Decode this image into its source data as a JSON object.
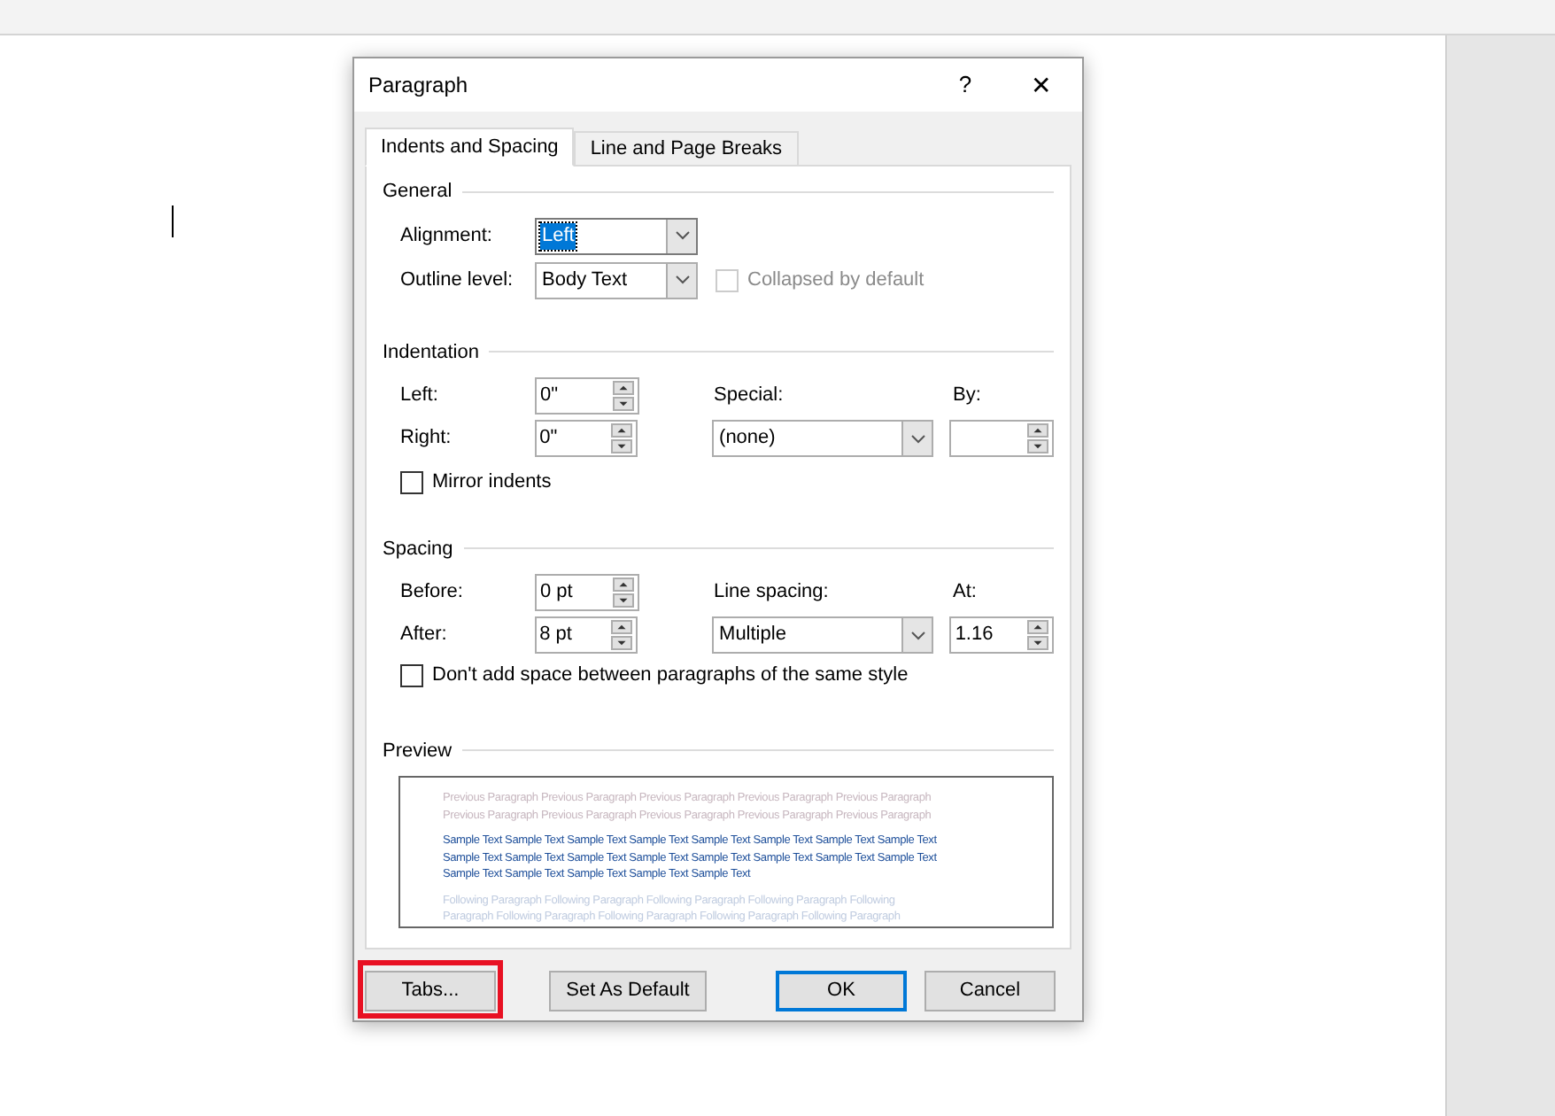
{
  "dialog": {
    "title": "Paragraph",
    "help": "?",
    "close": "✕"
  },
  "tabs": [
    {
      "label": "Indents and Spacing",
      "selected": true
    },
    {
      "label": "Line and Page Breaks",
      "selected": false
    }
  ],
  "general": {
    "heading": "General",
    "alignment": {
      "label": "Alignment:",
      "value": "Left",
      "focused": true
    },
    "outline": {
      "label": "Outline level:",
      "value": "Body Text",
      "focused": false
    },
    "collapsed": {
      "label": "Collapsed by default",
      "checked": false,
      "disabled": true
    }
  },
  "indentation": {
    "heading": "Indentation",
    "left": {
      "label": "Left:",
      "value": "0\""
    },
    "right": {
      "label": "Right:",
      "value": "0\""
    },
    "special": {
      "label": "Special:",
      "value": "(none)"
    },
    "by": {
      "label": "By:"
    },
    "mirror": {
      "label": "Mirror indents",
      "checked": false,
      "disabled": false
    }
  },
  "spacing": {
    "heading": "Spacing",
    "before": {
      "label": "Before:",
      "value": "0 pt"
    },
    "after": {
      "label": "After:",
      "value": "8 pt"
    },
    "line_spacing": {
      "label": "Line spacing:",
      "value": "Multiple"
    },
    "at": {
      "label": "At:",
      "value": "1.16"
    },
    "no_space": {
      "label": "Don't add space between paragraphs of the same style",
      "checked": false,
      "disabled": false
    }
  },
  "preview": {
    "heading": "Preview",
    "previous": [
      "Previous Paragraph Previous Paragraph Previous Paragraph Previous Paragraph Previous Paragraph",
      "Previous Paragraph Previous Paragraph Previous Paragraph Previous Paragraph Previous Paragraph"
    ],
    "sample": [
      "Sample Text Sample Text Sample Text Sample Text Sample Text Sample Text Sample Text Sample Text",
      "Sample Text Sample Text Sample Text Sample Text Sample Text Sample Text Sample Text Sample Text",
      "Sample Text Sample Text Sample Text Sample Text Sample Text"
    ],
    "following": [
      "Following Paragraph Following Paragraph Following Paragraph Following Paragraph Following",
      "Paragraph Following Paragraph Following Paragraph Following Paragraph Following Paragraph"
    ]
  },
  "buttons": [
    {
      "label": "Tabs...",
      "kind": "normal",
      "highlighted": true
    },
    {
      "label": "Set As Default",
      "kind": "normal",
      "highlighted": false
    },
    {
      "label": "OK",
      "kind": "default",
      "highlighted": false
    },
    {
      "label": "Cancel",
      "kind": "normal",
      "highlighted": false
    }
  ]
}
